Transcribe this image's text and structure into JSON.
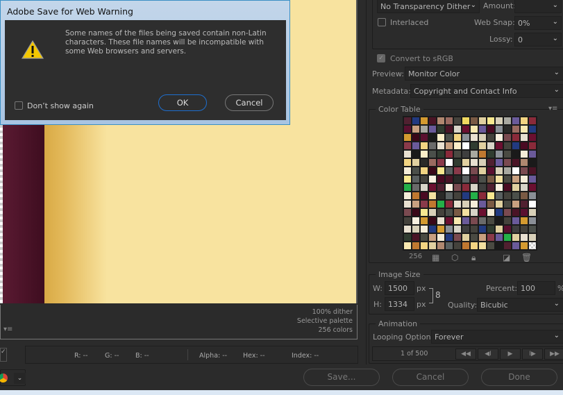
{
  "dialog": {
    "title": "Adobe Save for Web Warning",
    "message": "Some names of the files being saved contain non-Latin characters. These file names will be incompatible with some Web browsers and servers.",
    "dont_show_again": "Don’t show again",
    "ok": "OK",
    "cancel": "Cancel",
    "icon": "warning-icon"
  },
  "preview_info": {
    "dither": "100% dither",
    "palette": "Selective palette",
    "colors": "256 colors"
  },
  "readout": {
    "r": "R: --",
    "g": "G: --",
    "b": "B: --",
    "alpha": "Alpha: --",
    "hex": "Hex: --",
    "index": "Index: --"
  },
  "settings": {
    "transparency_dither": "No Transparency Dither",
    "amount_label": "Amount:",
    "amount_value": "",
    "interlaced": "Interlaced",
    "web_snap_label": "Web Snap:",
    "web_snap_value": "0%",
    "lossy_label": "Lossy:",
    "lossy_value": "0",
    "convert_srgb": "Convert to sRGB",
    "preview_label": "Preview:",
    "preview_value": "Monitor Color",
    "metadata_label": "Metadata:",
    "metadata_value": "Copyright and Contact Info"
  },
  "color_table": {
    "title": "Color Table",
    "count": "256",
    "palette": [
      "#4a4a42",
      "#6b0f30",
      "#8a3a4a",
      "#4b4f4a",
      "#f2d482",
      "#4a1426",
      "#d8d4c8",
      "#3e3e3e",
      "#f4ecd8",
      "#c07830",
      "#4a0a22",
      "#f2e0a0",
      "#5a1030",
      "#d8d0b8",
      "#44423c",
      "#6a5a9a",
      "#d49a30",
      "#3a0818",
      "#e8e0d0",
      "#c8a080",
      "#fbeec8",
      "#f0d860",
      "#7a4a50",
      "#8a8f96",
      "#2a2a28",
      "#9a6a60",
      "#a8a8a0",
      "#f8f0e0",
      "#303c30",
      "#8a2a3a",
      "#b08870",
      "#5a6060",
      "#f8e8b0",
      "#223a80",
      "#7a5a44",
      "#e0d0a0",
      "#f8e890",
      "#1a1a1a",
      "#502030",
      "#ffffff",
      "#24b048",
      "#6a6a6a"
    ]
  },
  "image_size": {
    "title": "Image Size",
    "w_label": "W:",
    "w_value": "1500",
    "h_label": "H:",
    "h_value": "1334",
    "unit": "px",
    "percent_label": "Percent:",
    "percent_value": "100",
    "percent_unit": "%",
    "quality_label": "Quality:",
    "quality_value": "Bicubic"
  },
  "animation": {
    "title": "Animation",
    "looping_label": "Looping Options:",
    "looping_value": "Forever",
    "frame": "1 of 500",
    "controls": [
      "◀◀",
      "◀I",
      "▶",
      "I▶",
      "▶▶"
    ]
  },
  "footer": {
    "save": "Save...",
    "cancel": "Cancel",
    "done": "Done"
  }
}
